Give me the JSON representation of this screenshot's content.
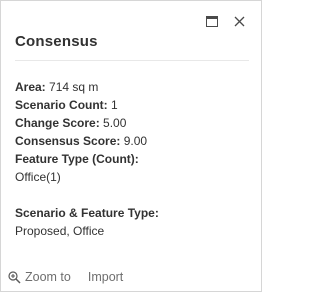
{
  "popup": {
    "title": "Consensus",
    "controls": {
      "dock_icon": "dock-icon",
      "close_icon": "close-icon"
    },
    "fields": [
      {
        "label": "Area:",
        "value": "714 sq m"
      },
      {
        "label": "Scenario Count:",
        "value": "1"
      },
      {
        "label": "Change Score:",
        "value": "5.00"
      },
      {
        "label": "Consensus Score:",
        "value": "9.00"
      }
    ],
    "feature_type": {
      "label": "Feature Type (Count):",
      "value": "Office(1)"
    },
    "scenario_feature_type": {
      "label": "Scenario & Feature Type:",
      "value": "Proposed, Office"
    },
    "actions": {
      "zoom_icon": "zoom-in-icon",
      "zoom_label": "Zoom to",
      "import_label": "Import"
    }
  }
}
